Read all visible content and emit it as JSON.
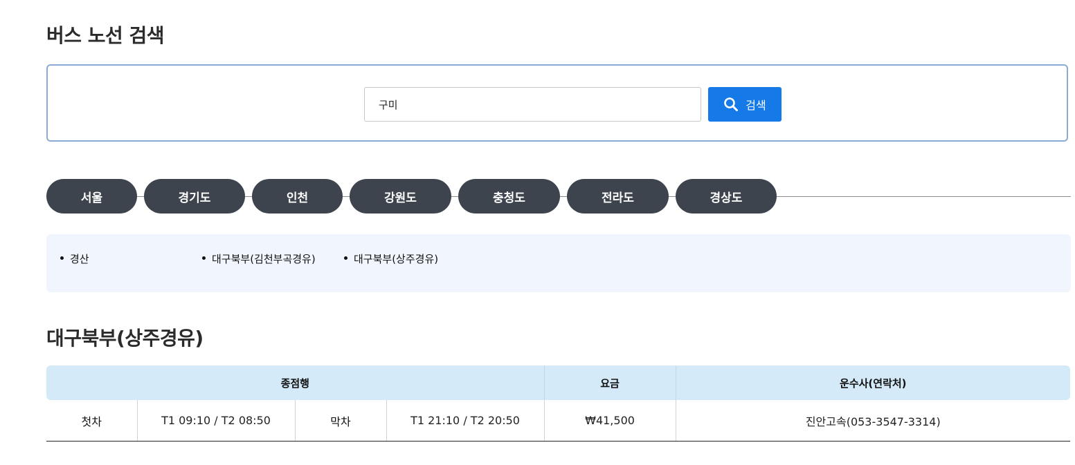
{
  "page_title": "버스 노선 검색",
  "search": {
    "value": "구미",
    "button_label": "검색"
  },
  "regions": [
    {
      "label": "서울"
    },
    {
      "label": "경기도"
    },
    {
      "label": "인천"
    },
    {
      "label": "강원도"
    },
    {
      "label": "충청도"
    },
    {
      "label": "전라도"
    },
    {
      "label": "경상도"
    }
  ],
  "destinations": [
    {
      "label": "경산"
    },
    {
      "label": "대구북부(김천부곡경유)"
    },
    {
      "label": "대구북부(상주경유)"
    }
  ],
  "route_title": "대구북부(상주경유)",
  "table": {
    "headers": {
      "destination": "종점행",
      "fare": "요금",
      "operator": "운수사(연락처)"
    },
    "row": {
      "first_label": "첫차",
      "first_time": "T1 09:10 / T2 08:50",
      "last_label": "막차",
      "last_time": "T1 21:10 / T2 20:50",
      "fare": "₩41,500",
      "operator": "진안고속(053-3547-3314)"
    }
  },
  "colors": {
    "accent": "#1679e8",
    "tab_bg": "#3d444d",
    "header_bg": "#d4eaf8",
    "panel_bg": "#f1f5fd"
  }
}
